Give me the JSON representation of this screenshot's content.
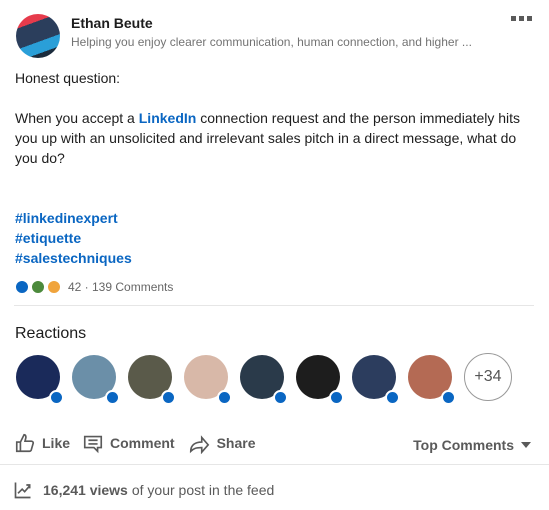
{
  "author": {
    "name": "Ethan Beute",
    "headline": "Helping you enjoy clearer communication, human connection, and higher ..."
  },
  "post": {
    "line1": "Honest question:",
    "para2_before": "When you accept a ",
    "para2_link": "LinkedIn",
    "para2_after": " connection request and the person immediately hits you up with an unsolicited and irrelevant sales pitch in a direct message, what do you do?",
    "hashtags": [
      "#linkedinexpert",
      "#etiquette",
      "#salestechniques"
    ]
  },
  "social": {
    "reaction_types": [
      "like",
      "support",
      "insightful"
    ],
    "count_text": "42 · 139 Comments"
  },
  "reactions": {
    "title": "Reactions",
    "reactor_colors": [
      "#1a2a5a",
      "#6b8fa8",
      "#5a5a4a",
      "#d8b8a8",
      "#2a3a4a",
      "#1d1d1d",
      "#2c3d5e",
      "#b46a54"
    ],
    "more_label": "+34"
  },
  "actions": {
    "like": "Like",
    "comment": "Comment",
    "share": "Share",
    "sort": "Top Comments"
  },
  "views": {
    "count": "16,241 views",
    "suffix": "of your post in the feed"
  }
}
